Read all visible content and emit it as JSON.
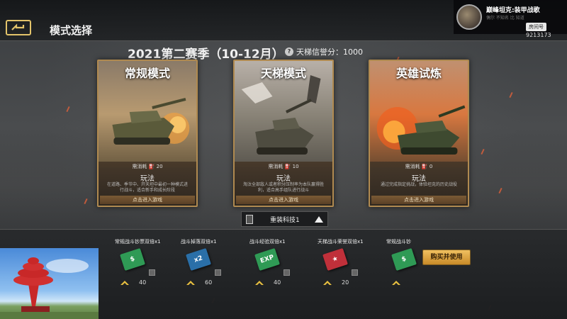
{
  "topbar": {
    "title": "模式选择"
  },
  "stream": {
    "title": "巅峰坦克:装甲战歌",
    "subtitle": "偶尔 不知名 比 知道",
    "tag": "房间号",
    "room_id": "9213173"
  },
  "season": {
    "title": "2021第二赛季（10-12月）",
    "credit_icon": "?",
    "credit_text": "天梯信誉分：1000"
  },
  "cards": [
    {
      "title": "常规模式",
      "cost_label": "需消耗",
      "cost_value": "20",
      "play_label": "玩法",
      "description": "在道路、季节中、开天坦中最初一种模式进行战斗，适合新手和成长阶段",
      "enter_label": "点击进入游戏"
    },
    {
      "title": "天梯模式",
      "cost_label": "需消耗",
      "cost_value": "10",
      "play_label": "玩法",
      "description": "淘汰全部敌人或者积分压制率为本队赢得胜利，适合高手组队进行战斗",
      "enter_label": "点击进入游戏"
    },
    {
      "title": "英雄试炼",
      "cost_label": "需消耗",
      "cost_value": "0",
      "play_label": "玩法",
      "description": "通过完成指定挑战，体验坦克的历史战役",
      "enter_label": "点击进入游戏"
    }
  ],
  "tech": {
    "label": "重装科技1"
  },
  "items": [
    {
      "name": "常规战斗钞票双倍x1",
      "card_text": "$",
      "count": "40",
      "color": "#2f9a55"
    },
    {
      "name": "战斗掉落双倍x1",
      "card_text": "x2",
      "count": "60",
      "color": "#2a6fa8"
    },
    {
      "name": "战斗经验双倍x1",
      "card_text": "EXP",
      "count": "40",
      "color": "#2f9a55"
    },
    {
      "name": "天梯战斗荣誉双倍x1",
      "card_text": "★",
      "count": "20",
      "color": "#c0303a"
    },
    {
      "name": "常规战斗钞",
      "card_text": "$",
      "count": "",
      "color": "#2f9a55"
    }
  ],
  "buy_button": "购买并使用",
  "colors": {
    "card_border": "#b08a50",
    "buy_gold": "#f0c060"
  }
}
